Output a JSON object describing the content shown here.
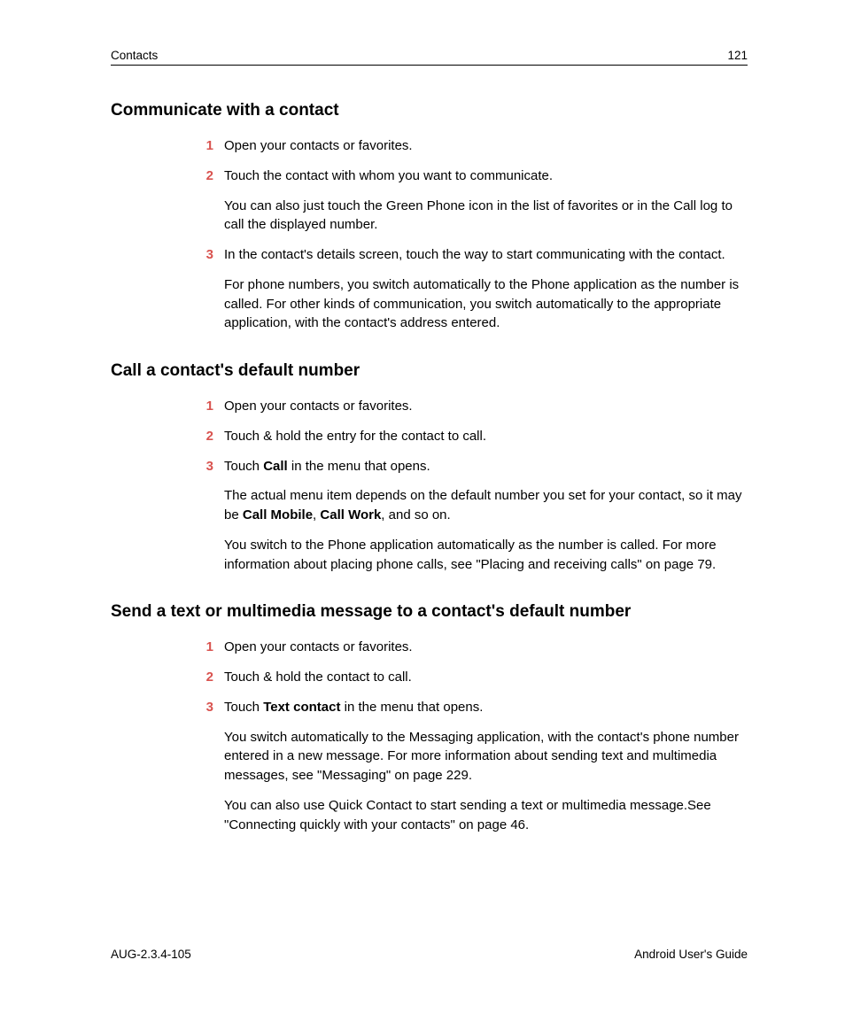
{
  "header": {
    "left": "Contacts",
    "right": "121"
  },
  "sections": [
    {
      "heading": "Communicate with a contact",
      "items": [
        {
          "num": "1",
          "text": "Open your contacts or favorites."
        },
        {
          "num": "2",
          "text": "Touch the contact with whom you want to communicate."
        },
        {
          "followup": "You can also just touch the Green Phone icon in the list of favorites or in the Call log to call the displayed number."
        },
        {
          "num": "3",
          "text": "In the contact's details screen, touch the way to start communicating with the contact."
        },
        {
          "followup": "For phone numbers, you switch automatically to the Phone application as the number is called. For other kinds of communication, you switch automatically to the appropriate application, with the contact's address entered."
        }
      ]
    },
    {
      "heading": "Call a contact's default number",
      "items": [
        {
          "num": "1",
          "text": "Open your contacts or favorites."
        },
        {
          "num": "2",
          "text": "Touch & hold the entry for the contact to call."
        },
        {
          "num": "3",
          "runs": [
            {
              "t": "Touch "
            },
            {
              "t": "Call",
              "b": true
            },
            {
              "t": " in the menu that opens."
            }
          ]
        },
        {
          "followup_runs": [
            {
              "t": "The actual menu item depends on the default number you set for your contact, so it may be "
            },
            {
              "t": "Call Mobile",
              "b": true
            },
            {
              "t": ", "
            },
            {
              "t": "Call Work",
              "b": true
            },
            {
              "t": ", and so on."
            }
          ]
        },
        {
          "followup": "You switch to the Phone application automatically as the number is called. For more information about placing phone calls, see \"Placing and receiving calls\" on page 79."
        }
      ]
    },
    {
      "heading": "Send a text or multimedia message to a contact's default number",
      "items": [
        {
          "num": "1",
          "text": "Open your contacts or favorites."
        },
        {
          "num": "2",
          "text": "Touch & hold the contact to call."
        },
        {
          "num": "3",
          "runs": [
            {
              "t": "Touch "
            },
            {
              "t": "Text contact",
              "b": true
            },
            {
              "t": " in the menu that opens."
            }
          ]
        },
        {
          "followup": "You switch automatically to the Messaging application, with the contact's phone number entered in a new message. For more information about sending text and multimedia messages, see \"Messaging\" on page 229."
        },
        {
          "followup": "You can also use Quick Contact to start sending a text or multimedia message.See \"Connecting quickly with your contacts\" on page 46."
        }
      ]
    }
  ],
  "footer": {
    "left": "AUG-2.3.4-105",
    "right": "Android User's Guide"
  }
}
